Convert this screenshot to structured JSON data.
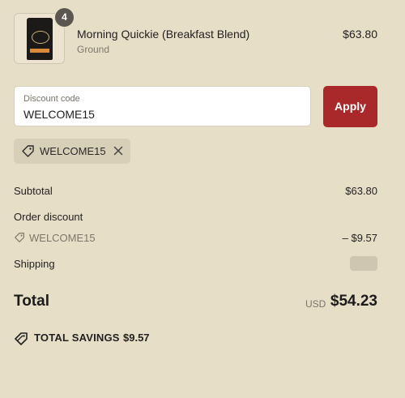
{
  "product": {
    "quantity": "4",
    "name": "Morning Quickie (Breakfast Blend)",
    "variant": "Ground",
    "price": "$63.80"
  },
  "discount": {
    "label": "Discount code",
    "value": "WELCOME15",
    "apply_label": "Apply",
    "applied_code": "WELCOME15"
  },
  "summary": {
    "subtotal_label": "Subtotal",
    "subtotal_value": "$63.80",
    "order_discount_label": "Order discount",
    "order_discount_code": "WELCOME15",
    "order_discount_value": "– $9.57",
    "shipping_label": "Shipping",
    "total_label": "Total",
    "currency": "USD",
    "total_value": "$54.23",
    "savings_label": "TOTAL SAVINGS",
    "savings_value": "$9.57"
  },
  "colors": {
    "background": "#e7dec8",
    "accent": "#a9282a",
    "chip": "#d8cfb9"
  },
  "icons": {
    "tag": "tag-icon",
    "close": "close-icon",
    "savings": "savings-tag-icon"
  }
}
